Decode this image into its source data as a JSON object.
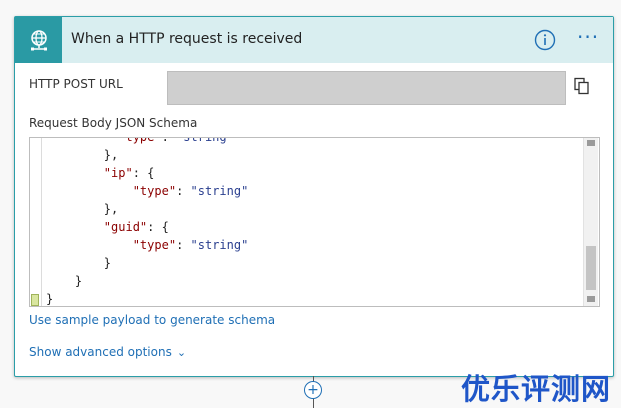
{
  "trigger": {
    "title": "When a HTTP request is received",
    "icon": "globe-network-icon",
    "accent_color": "#2a9aa4",
    "header_bg": "#d9eef0"
  },
  "url_field": {
    "label": "HTTP POST URL",
    "value": ""
  },
  "schema": {
    "label": "Request Body JSON Schema",
    "lines": [
      "          \"type\": \"string\"",
      "        },",
      "        \"ip\": {",
      "            \"type\": \"string\"",
      "        },",
      "        \"guid\": {",
      "            \"type\": \"string\"",
      "        }",
      "    }",
      "}"
    ]
  },
  "links": {
    "sample_payload": "Use sample payload to generate schema",
    "advanced_options": "Show advanced options"
  },
  "watermark": "优乐评测网"
}
